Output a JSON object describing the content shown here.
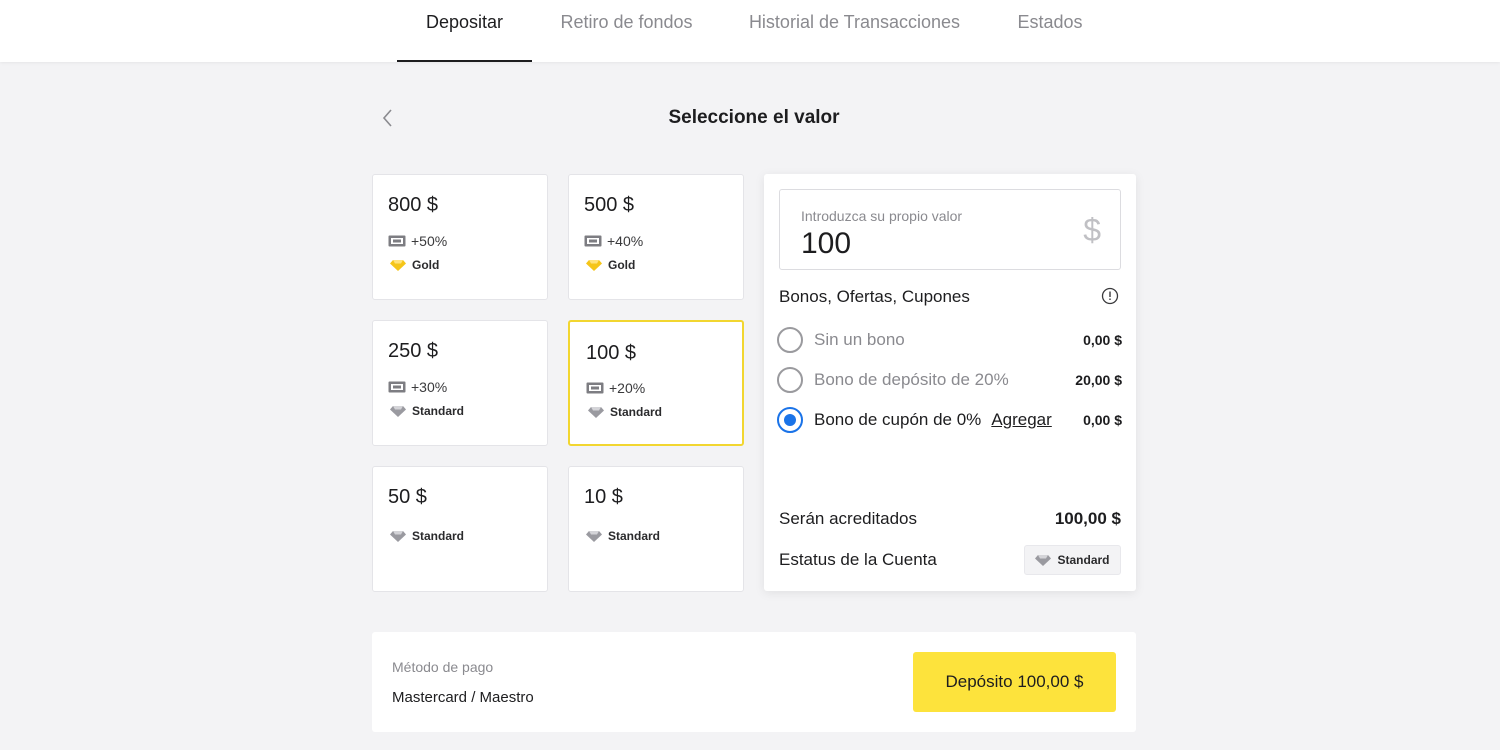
{
  "tabs": [
    {
      "label": "Depositar",
      "active": true
    },
    {
      "label": "Retiro de fondos",
      "active": false
    },
    {
      "label": "Historial de Transacciones",
      "active": false
    },
    {
      "label": "Estados",
      "active": false
    }
  ],
  "header": {
    "title": "Seleccione el valor",
    "back_icon": "chevron-left-icon"
  },
  "cards": [
    {
      "amount": "800 $",
      "bonus": "+50%",
      "status": "Gold",
      "selected": false
    },
    {
      "amount": "500 $",
      "bonus": "+40%",
      "status": "Gold",
      "selected": false
    },
    {
      "amount": "250 $",
      "bonus": "+30%",
      "status": "Standard",
      "selected": false
    },
    {
      "amount": "100 $",
      "bonus": "+20%",
      "status": "Standard",
      "selected": true
    },
    {
      "amount": "50 $",
      "bonus": null,
      "status": "Standard",
      "selected": false
    },
    {
      "amount": "10 $",
      "bonus": null,
      "status": "Standard",
      "selected": false
    }
  ],
  "panel": {
    "input_label": "Introduzca su propio valor",
    "input_value": "100",
    "currency_symbol": "$",
    "bonus_title": "Bonos, Ofertas, Cupones",
    "options": [
      {
        "label": "Sin un bono",
        "amount": "0,00 $",
        "selected": false
      },
      {
        "label": "Bono de depósito de 20%",
        "amount": "20,00 $",
        "selected": false
      },
      {
        "label": "Bono de cupón de 0%",
        "link": "Agregar",
        "amount": "0,00 $",
        "selected": true
      }
    ],
    "credited_label": "Serán acreditados",
    "credited_value": "100,00 $",
    "account_status_label": "Estatus de la Cuenta",
    "account_status_value": "Standard"
  },
  "payment": {
    "label": "Método de pago",
    "method": "Mastercard / Maestro",
    "deposit_button": "Depósito 100,00 $"
  },
  "colors": {
    "accent_yellow": "#fde33c",
    "selected_border": "#f2d630",
    "radio_blue": "#1a73e8",
    "gold_gem": "#f5c518",
    "standard_gem": "#9a9aa0"
  }
}
